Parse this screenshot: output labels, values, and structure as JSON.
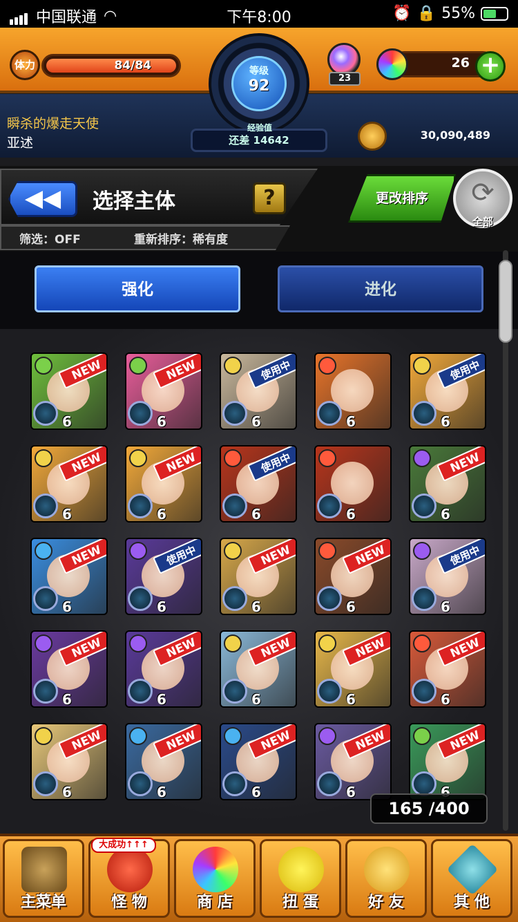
{
  "status_bar": {
    "carrier": "中国联通",
    "time": "下午8:00",
    "battery": "55%"
  },
  "hud": {
    "stamina_label": "体力",
    "stamina_value": "84/84",
    "level_label": "等级",
    "level": "92",
    "exp_label": "经验值",
    "exp_text": "还差 14642",
    "gem_count": "23",
    "orb_count": "26",
    "plus": "+",
    "title": "瞬杀的爆走天使",
    "name": "亚述",
    "coins": "30,090,489"
  },
  "panel": {
    "back": "◀◀",
    "title": "选择主体",
    "help": "?",
    "filter": "筛选：OFF",
    "sort": "重新排序：稀有度",
    "change_sort": "更改排序",
    "refresh_label": "全部",
    "refresh_icon": "⟳"
  },
  "tabs": {
    "strengthen": "强化",
    "evolve": "进化"
  },
  "monsters": [
    {
      "badge": "NEW",
      "level": "6",
      "bg": "#6fbf3c",
      "elem": "#7bd04a"
    },
    {
      "badge": "NEW",
      "level": "6",
      "bg": "#e85d9a",
      "elem": "#7bd04a"
    },
    {
      "badge": "使用中",
      "level": "6",
      "bg": "#c9b89c",
      "elem": "#f1d24a"
    },
    {
      "badge": "",
      "level": "6",
      "bg": "#e8742a",
      "elem": "#ff5a3c"
    },
    {
      "badge": "使用中",
      "level": "6",
      "bg": "#f2a93a",
      "elem": "#f1d24a"
    },
    {
      "badge": "NEW",
      "level": "6",
      "bg": "#f2a93a",
      "elem": "#f1d24a"
    },
    {
      "badge": "NEW",
      "level": "6",
      "bg": "#f2a93a",
      "elem": "#f1d24a"
    },
    {
      "badge": "使用中",
      "level": "6",
      "bg": "#b8351c",
      "elem": "#ff5a3c"
    },
    {
      "badge": "",
      "level": "6",
      "bg": "#b8351c",
      "elem": "#ff5a3c"
    },
    {
      "badge": "NEW",
      "level": "6",
      "bg": "#4a7a3a",
      "elem": "#9b5cf0"
    },
    {
      "badge": "NEW",
      "level": "6",
      "bg": "#3a8ee0",
      "elem": "#4ab2f0"
    },
    {
      "badge": "使用中",
      "level": "6",
      "bg": "#5a3a9a",
      "elem": "#9b5cf0"
    },
    {
      "badge": "NEW",
      "level": "6",
      "bg": "#d7a84a",
      "elem": "#f1d24a"
    },
    {
      "badge": "NEW",
      "level": "6",
      "bg": "#8a4a2a",
      "elem": "#ff5a3c"
    },
    {
      "badge": "使用中",
      "level": "6",
      "bg": "#c9a9c9",
      "elem": "#9b5cf0"
    },
    {
      "badge": "NEW",
      "level": "6",
      "bg": "#6a3aa0",
      "elem": "#9b5cf0"
    },
    {
      "badge": "NEW",
      "level": "6",
      "bg": "#5a3a9a",
      "elem": "#9b5cf0"
    },
    {
      "badge": "NEW",
      "level": "6",
      "bg": "#8ab8d8",
      "elem": "#f1d24a"
    },
    {
      "badge": "NEW",
      "level": "6",
      "bg": "#e8b84a",
      "elem": "#f1d24a"
    },
    {
      "badge": "NEW",
      "level": "6",
      "bg": "#d85a3a",
      "elem": "#ff5a3c"
    },
    {
      "badge": "NEW",
      "level": "6",
      "bg": "#e8c87a",
      "elem": "#f1d24a"
    },
    {
      "badge": "NEW",
      "level": "6",
      "bg": "#3a6aa0",
      "elem": "#4ab2f0"
    },
    {
      "badge": "NEW",
      "level": "6",
      "bg": "#2a4a8a",
      "elem": "#4ab2f0"
    },
    {
      "badge": "NEW",
      "level": "6",
      "bg": "#6a5aa0",
      "elem": "#9b5cf0"
    },
    {
      "badge": "NEW",
      "level": "6",
      "bg": "#3a9a5a",
      "elem": "#7bd04a"
    }
  ],
  "counter": "165 /400",
  "nav": {
    "main_menu": "主菜单",
    "monsters": "怪 物",
    "boost": "大成功↑↑↑",
    "shop": "商 店",
    "gacha": "扭 蛋",
    "friends": "好 友",
    "other": "其 他"
  },
  "colors": {
    "accent_orange": "#f2961e",
    "tab_blue": "#1446b8",
    "new_red": "#d22222"
  }
}
